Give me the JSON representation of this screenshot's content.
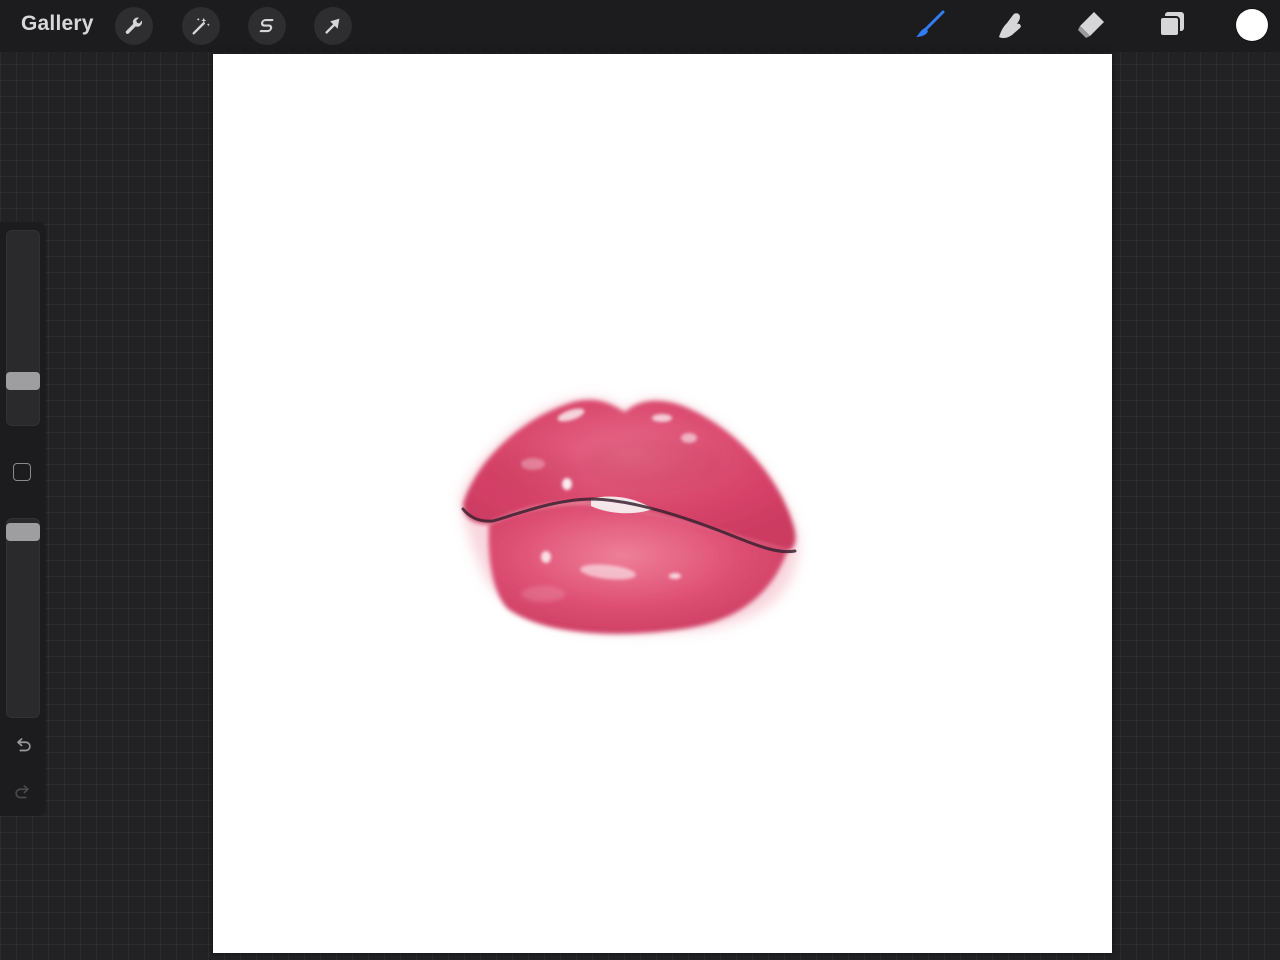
{
  "topbar": {
    "gallery_label": "Gallery",
    "left_tools": [
      {
        "name": "actions",
        "icon": "wrench-icon"
      },
      {
        "name": "adjustments",
        "icon": "magic-wand-icon"
      },
      {
        "name": "selection",
        "icon": "selection-s-icon"
      },
      {
        "name": "transform",
        "icon": "arrow-cursor-icon"
      }
    ],
    "right_tools": [
      {
        "name": "brush",
        "icon": "brush-icon",
        "active": true
      },
      {
        "name": "smudge",
        "icon": "smudge-finger-icon",
        "active": false
      },
      {
        "name": "eraser",
        "icon": "eraser-icon",
        "active": false
      },
      {
        "name": "layers",
        "icon": "layers-icon",
        "active": false
      }
    ],
    "current_color": "#ffffff"
  },
  "sidebar": {
    "brush_size_level": 0.2,
    "opacity_level": 0.97,
    "icons": [
      "modify-square-icon",
      "undo-icon",
      "redo-icon"
    ]
  },
  "colors": {
    "accent": "#2f7cf6",
    "lip_base": "#d8456a",
    "lip_shadow": "#b8304f",
    "lip_outline": "#3a2230",
    "canvas": "#ffffff"
  }
}
